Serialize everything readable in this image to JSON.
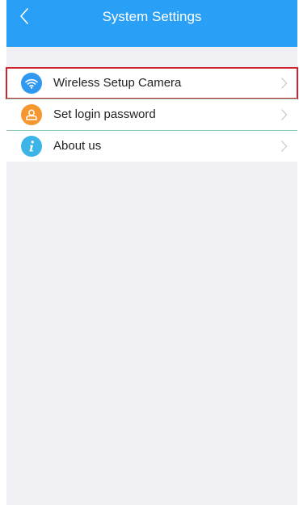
{
  "header": {
    "title": "System Settings",
    "back_icon": "chevron-left-icon"
  },
  "settings": {
    "items": [
      {
        "label": "Wireless Setup Camera",
        "icon": "wifi-icon",
        "icon_color": "#2f98f0",
        "selected": true
      },
      {
        "label": "Set login password",
        "icon": "user-icon",
        "icon_color": "#f5962e",
        "selected": false
      },
      {
        "label": "About us",
        "icon": "info-icon",
        "icon_color": "#3cb4e8",
        "selected": false
      }
    ]
  },
  "colors": {
    "accent": "#2a9ff6",
    "background": "#efeff4",
    "selection_outline": "#d0252f",
    "divider": "#8cccb7"
  }
}
